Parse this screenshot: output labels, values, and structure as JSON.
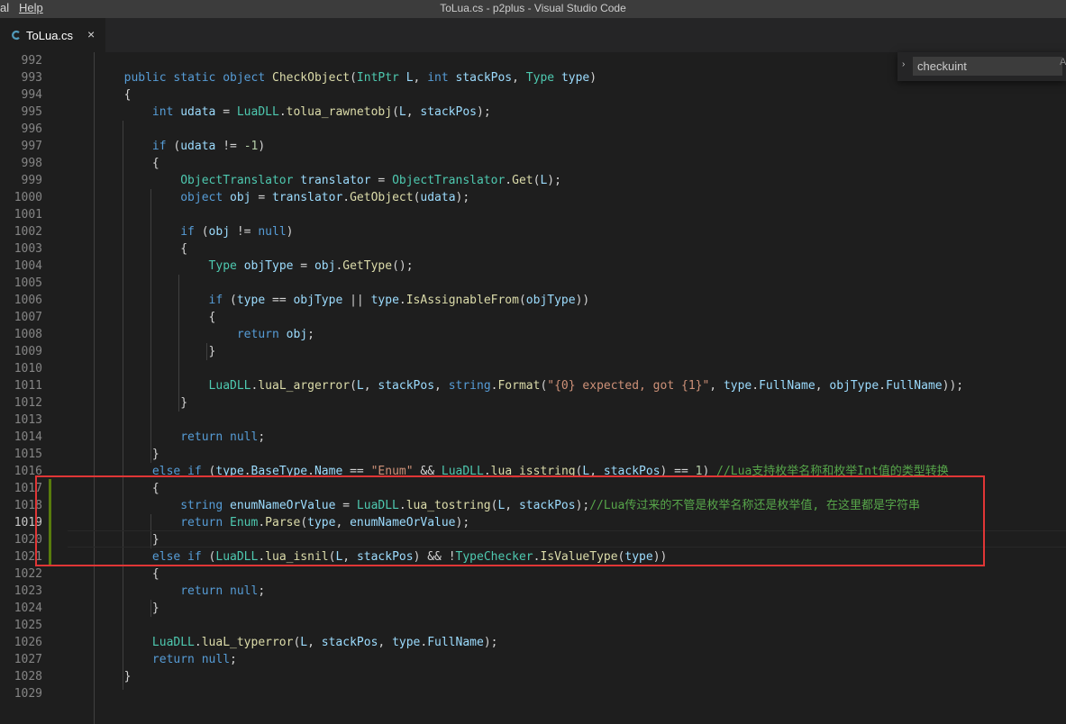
{
  "menu": {
    "partial_item": "al",
    "help": "Help"
  },
  "window_title": "ToLua.cs - p2plus - Visual Studio Code",
  "tab": {
    "label": "ToLua.cs",
    "close_glyph": "×",
    "icon": "csharp-file-icon"
  },
  "find": {
    "value": "checkuint",
    "toggle_glyph": "›",
    "option_glyph": "A"
  },
  "colors": {
    "keyword": "#569cd6",
    "type": "#4ec9b0",
    "method": "#dcdcaa",
    "string": "#ce9178",
    "comment": "#57a64a",
    "highlight_box": "#e03636",
    "git_modified": "#587c0c"
  },
  "lines": [
    {
      "n": "992",
      "c": []
    },
    {
      "n": "993",
      "c": [
        [
          "",
          "        "
        ],
        [
          "kw",
          "public static object "
        ],
        [
          "fn",
          "CheckObject"
        ],
        [
          "",
          "("
        ],
        [
          "ty",
          "IntPtr"
        ],
        [
          "",
          " "
        ],
        [
          "vr",
          "L"
        ],
        [
          "",
          ", "
        ],
        [
          "kw",
          "int "
        ],
        [
          "vr",
          "stackPos"
        ],
        [
          "",
          ", "
        ],
        [
          "ty",
          "Type"
        ],
        [
          "",
          " "
        ],
        [
          "vr",
          "type"
        ],
        [
          "",
          ")"
        ]
      ]
    },
    {
      "n": "994",
      "c": [
        [
          "",
          "        {"
        ]
      ]
    },
    {
      "n": "995",
      "c": [
        [
          "",
          "            "
        ],
        [
          "kw",
          "int "
        ],
        [
          "vr",
          "udata"
        ],
        [
          "",
          " = "
        ],
        [
          "ty",
          "LuaDLL"
        ],
        [
          "",
          "."
        ],
        [
          "fn",
          "tolua_rawnetobj"
        ],
        [
          "",
          "("
        ],
        [
          "vr",
          "L"
        ],
        [
          "",
          ", "
        ],
        [
          "vr",
          "stackPos"
        ],
        [
          "",
          ");"
        ]
      ]
    },
    {
      "n": "996",
      "c": []
    },
    {
      "n": "997",
      "c": [
        [
          "",
          "            "
        ],
        [
          "kw",
          "if "
        ],
        [
          "",
          "("
        ],
        [
          "vr",
          "udata"
        ],
        [
          "",
          " != "
        ],
        [
          "nm",
          "-1"
        ],
        [
          "",
          ")"
        ]
      ]
    },
    {
      "n": "998",
      "c": [
        [
          "",
          "            {"
        ]
      ]
    },
    {
      "n": "999",
      "c": [
        [
          "",
          "                "
        ],
        [
          "ty",
          "ObjectTranslator"
        ],
        [
          "",
          " "
        ],
        [
          "vr",
          "translator"
        ],
        [
          "",
          " = "
        ],
        [
          "ty",
          "ObjectTranslator"
        ],
        [
          "",
          "."
        ],
        [
          "fn",
          "Get"
        ],
        [
          "",
          "("
        ],
        [
          "vr",
          "L"
        ],
        [
          "",
          ");"
        ]
      ]
    },
    {
      "n": "1000",
      "c": [
        [
          "",
          "                "
        ],
        [
          "kw",
          "object "
        ],
        [
          "vr",
          "obj"
        ],
        [
          "",
          " = "
        ],
        [
          "vr",
          "translator"
        ],
        [
          "",
          "."
        ],
        [
          "fn",
          "GetObject"
        ],
        [
          "",
          "("
        ],
        [
          "vr",
          "udata"
        ],
        [
          "",
          ");"
        ]
      ]
    },
    {
      "n": "1001",
      "c": []
    },
    {
      "n": "1002",
      "c": [
        [
          "",
          "                "
        ],
        [
          "kw",
          "if "
        ],
        [
          "",
          "("
        ],
        [
          "vr",
          "obj"
        ],
        [
          "",
          " != "
        ],
        [
          "kw",
          "null"
        ],
        [
          "",
          ")"
        ]
      ]
    },
    {
      "n": "1003",
      "c": [
        [
          "",
          "                {"
        ]
      ]
    },
    {
      "n": "1004",
      "c": [
        [
          "",
          "                    "
        ],
        [
          "ty",
          "Type"
        ],
        [
          "",
          " "
        ],
        [
          "vr",
          "objType"
        ],
        [
          "",
          " = "
        ],
        [
          "vr",
          "obj"
        ],
        [
          "",
          "."
        ],
        [
          "fn",
          "GetType"
        ],
        [
          "",
          "();"
        ]
      ]
    },
    {
      "n": "1005",
      "c": []
    },
    {
      "n": "1006",
      "c": [
        [
          "",
          "                    "
        ],
        [
          "kw",
          "if "
        ],
        [
          "",
          "("
        ],
        [
          "vr",
          "type"
        ],
        [
          "",
          " == "
        ],
        [
          "vr",
          "objType"
        ],
        [
          "",
          " || "
        ],
        [
          "vr",
          "type"
        ],
        [
          "",
          "."
        ],
        [
          "fn",
          "IsAssignableFrom"
        ],
        [
          "",
          "("
        ],
        [
          "vr",
          "objType"
        ],
        [
          "",
          "))"
        ]
      ]
    },
    {
      "n": "1007",
      "c": [
        [
          "",
          "                    {"
        ]
      ]
    },
    {
      "n": "1008",
      "c": [
        [
          "",
          "                        "
        ],
        [
          "kw",
          "return "
        ],
        [
          "vr",
          "obj"
        ],
        [
          "",
          ";"
        ]
      ]
    },
    {
      "n": "1009",
      "c": [
        [
          "",
          "                    }"
        ]
      ]
    },
    {
      "n": "1010",
      "c": []
    },
    {
      "n": "1011",
      "c": [
        [
          "",
          "                    "
        ],
        [
          "ty",
          "LuaDLL"
        ],
        [
          "",
          "."
        ],
        [
          "fn",
          "luaL_argerror"
        ],
        [
          "",
          "("
        ],
        [
          "vr",
          "L"
        ],
        [
          "",
          ", "
        ],
        [
          "vr",
          "stackPos"
        ],
        [
          "",
          ", "
        ],
        [
          "kw",
          "string"
        ],
        [
          "",
          "."
        ],
        [
          "fn",
          "Format"
        ],
        [
          "",
          "("
        ],
        [
          "st",
          "\"{0} expected, got {1}\""
        ],
        [
          "",
          ", "
        ],
        [
          "vr",
          "type"
        ],
        [
          "",
          "."
        ],
        [
          "vr",
          "FullName"
        ],
        [
          "",
          ", "
        ],
        [
          "vr",
          "objType"
        ],
        [
          "",
          "."
        ],
        [
          "vr",
          "FullName"
        ],
        [
          "",
          "));"
        ]
      ]
    },
    {
      "n": "1012",
      "c": [
        [
          "",
          "                }"
        ]
      ]
    },
    {
      "n": "1013",
      "c": []
    },
    {
      "n": "1014",
      "c": [
        [
          "",
          "                "
        ],
        [
          "kw",
          "return null"
        ],
        [
          "",
          ";"
        ]
      ]
    },
    {
      "n": "1015",
      "c": [
        [
          "",
          "            }"
        ]
      ]
    },
    {
      "n": "1016",
      "c": [
        [
          "",
          "            "
        ],
        [
          "kw",
          "else if "
        ],
        [
          "",
          "("
        ],
        [
          "vr",
          "type"
        ],
        [
          "",
          "."
        ],
        [
          "vr",
          "BaseType"
        ],
        [
          "",
          "."
        ],
        [
          "vr",
          "Name"
        ],
        [
          "",
          " == "
        ],
        [
          "st",
          "\"Enum\""
        ],
        [
          "",
          " && "
        ],
        [
          "ty",
          "LuaDLL"
        ],
        [
          "",
          "."
        ],
        [
          "fn",
          "lua_isstring"
        ],
        [
          "",
          "("
        ],
        [
          "vr",
          "L"
        ],
        [
          "",
          ", "
        ],
        [
          "vr",
          "stackPos"
        ],
        [
          "",
          ") == "
        ],
        [
          "nm",
          "1"
        ],
        [
          "",
          ") "
        ],
        [
          "cm",
          "//Lua支持枚举名称和枚举Int值的类型转换"
        ]
      ]
    },
    {
      "n": "1017",
      "c": [
        [
          "",
          "            {"
        ]
      ]
    },
    {
      "n": "1018",
      "c": [
        [
          "",
          "                "
        ],
        [
          "kw",
          "string "
        ],
        [
          "vr",
          "enumNameOrValue"
        ],
        [
          "",
          " = "
        ],
        [
          "ty",
          "LuaDLL"
        ],
        [
          "",
          "."
        ],
        [
          "fn",
          "lua_tostring"
        ],
        [
          "",
          "("
        ],
        [
          "vr",
          "L"
        ],
        [
          "",
          ", "
        ],
        [
          "vr",
          "stackPos"
        ],
        [
          "",
          ");"
        ],
        [
          "cm",
          "//Lua传过来的不管是枚举名称还是枚举值, 在这里都是字符串"
        ]
      ]
    },
    {
      "n": "1019",
      "c": [
        [
          "",
          "                "
        ],
        [
          "kw",
          "return "
        ],
        [
          "ty",
          "Enum"
        ],
        [
          "",
          "."
        ],
        [
          "fn",
          "Parse"
        ],
        [
          "",
          "("
        ],
        [
          "vr",
          "type"
        ],
        [
          "",
          ", "
        ],
        [
          "vr",
          "enumNameOrValue"
        ],
        [
          "",
          ");"
        ]
      ]
    },
    {
      "n": "1020",
      "c": [
        [
          "",
          "            }"
        ]
      ]
    },
    {
      "n": "1021",
      "c": [
        [
          "",
          "            "
        ],
        [
          "kw",
          "else if "
        ],
        [
          "",
          "("
        ],
        [
          "ty",
          "LuaDLL"
        ],
        [
          "",
          "."
        ],
        [
          "fn",
          "lua_isnil"
        ],
        [
          "",
          "("
        ],
        [
          "vr",
          "L"
        ],
        [
          "",
          ", "
        ],
        [
          "vr",
          "stackPos"
        ],
        [
          "",
          ") && !"
        ],
        [
          "ty",
          "TypeChecker"
        ],
        [
          "",
          "."
        ],
        [
          "fn",
          "IsValueType"
        ],
        [
          "",
          "("
        ],
        [
          "vr",
          "type"
        ],
        [
          "",
          "))"
        ]
      ]
    },
    {
      "n": "1022",
      "c": [
        [
          "",
          "            {"
        ]
      ]
    },
    {
      "n": "1023",
      "c": [
        [
          "",
          "                "
        ],
        [
          "kw",
          "return null"
        ],
        [
          "",
          ";"
        ]
      ]
    },
    {
      "n": "1024",
      "c": [
        [
          "",
          "            }"
        ]
      ]
    },
    {
      "n": "1025",
      "c": []
    },
    {
      "n": "1026",
      "c": [
        [
          "",
          "            "
        ],
        [
          "ty",
          "LuaDLL"
        ],
        [
          "",
          "."
        ],
        [
          "fn",
          "luaL_typerror"
        ],
        [
          "",
          "("
        ],
        [
          "vr",
          "L"
        ],
        [
          "",
          ", "
        ],
        [
          "vr",
          "stackPos"
        ],
        [
          "",
          ", "
        ],
        [
          "vr",
          "type"
        ],
        [
          "",
          "."
        ],
        [
          "vr",
          "FullName"
        ],
        [
          "",
          ");"
        ]
      ]
    },
    {
      "n": "1027",
      "c": [
        [
          "",
          "            "
        ],
        [
          "kw",
          "return null"
        ],
        [
          "",
          ";"
        ]
      ]
    },
    {
      "n": "1028",
      "c": [
        [
          "",
          "        }"
        ]
      ]
    },
    {
      "n": "1029",
      "c": []
    }
  ],
  "active_line": "1019"
}
